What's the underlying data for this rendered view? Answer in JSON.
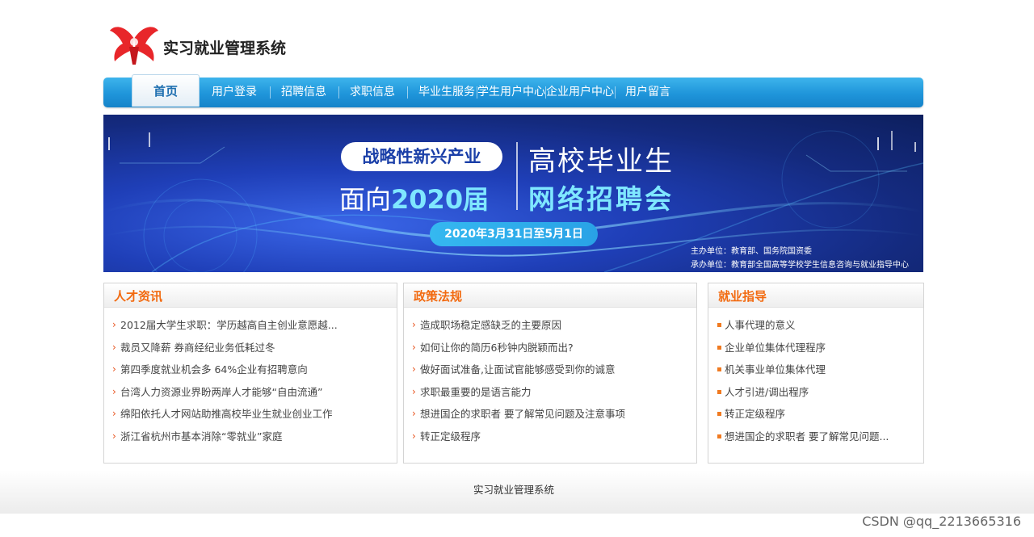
{
  "header": {
    "site_title": "实习就业管理系统",
    "logo_icon": "red-ribbon-logo",
    "brand_color": "#e8262a"
  },
  "nav": {
    "accent": "#1f95da",
    "items": [
      {
        "label": "首页",
        "active": true
      },
      {
        "label": "用户登录"
      },
      {
        "label": "招聘信息"
      },
      {
        "label": "求职信息"
      },
      {
        "label": "毕业生服务"
      },
      {
        "label": "学生用户中心"
      },
      {
        "label": "企业用户中心"
      },
      {
        "label": "用户留言"
      }
    ]
  },
  "banner": {
    "pill_text": "战略性新兴产业",
    "line2_prefix": "面向",
    "line2_highlight": "2020届",
    "right_line1": "高校毕业生",
    "right_line2": "网络招聘会",
    "date": "2020年3月31日至5月1日",
    "host": "主办单位：教育部、国务院国资委",
    "organizer": "承办单位：教育部全国高等学校学生信息咨询与就业指导中心"
  },
  "panels": {
    "talent_news": {
      "title": "人才资讯",
      "bullet": "›",
      "items": [
        "2012届大学生求职：学历越高自主创业意愿越...",
        "裁员又降薪 券商经纪业务低耗过冬",
        "第四季度就业机会多 64%企业有招聘意向",
        "台湾人力资源业界盼两岸人才能够“自由流通”",
        "绵阳依托人才网站助推高校毕业生就业创业工作",
        "浙江省杭州市基本消除“零就业”家庭"
      ]
    },
    "policy": {
      "title": "政策法规",
      "bullet": "›",
      "items": [
        "造成职场稳定感缺乏的主要原因",
        "如何让你的简历6秒钟内脱颖而出?",
        "做好面试准备,让面试官能够感受到你的诚意",
        "求职最重要的是语言能力",
        "想进国企的求职者 要了解常见问题及注意事项",
        "转正定级程序"
      ]
    },
    "guidance": {
      "title": "就业指导",
      "items": [
        "人事代理的意义",
        "企业单位集体代理程序",
        "机关事业单位集体代理",
        "人才引进/调出程序",
        "转正定级程序",
        "想进国企的求职者 要了解常见问题..."
      ]
    }
  },
  "footer": {
    "text": "实习就业管理系统",
    "watermark": "CSDN @qq_2213665316"
  }
}
